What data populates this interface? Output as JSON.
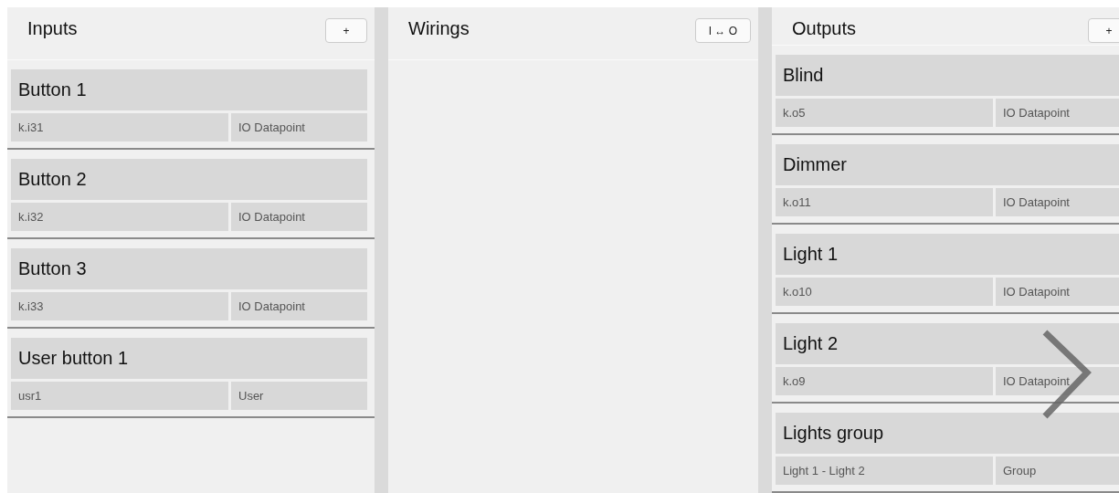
{
  "columns": [
    {
      "kind": "list",
      "title": "Inputs",
      "button": "+",
      "items": [
        {
          "name": "Button 1",
          "address": "k.i31",
          "type": "IO Datapoint"
        },
        {
          "name": "Button 2",
          "address": "k.i32",
          "type": "IO Datapoint"
        },
        {
          "name": "Button 3",
          "address": "k.i33",
          "type": "IO Datapoint"
        },
        {
          "name": "User button 1",
          "address": "usr1",
          "type": "User"
        }
      ]
    },
    {
      "kind": "wirings",
      "title": "Wirings",
      "button": "I ↔ O"
    },
    {
      "kind": "list",
      "title": "Outputs",
      "button": "+",
      "items": [
        {
          "name": "Blind",
          "address": "k.o5",
          "type": "IO Datapoint"
        },
        {
          "name": "Dimmer",
          "address": "k.o11",
          "type": "IO Datapoint"
        },
        {
          "name": "Light 1",
          "address": "k.o10",
          "type": "IO Datapoint"
        },
        {
          "name": "Light 2",
          "address": "k.o9",
          "type": "IO Datapoint"
        },
        {
          "name": "Lights group",
          "address": "Light 1 - Light 2",
          "type": "Group"
        }
      ]
    }
  ]
}
